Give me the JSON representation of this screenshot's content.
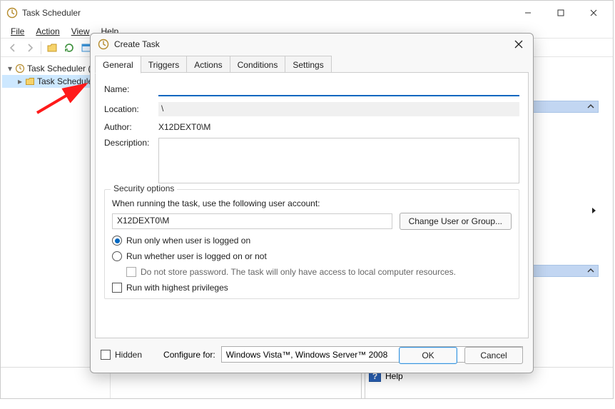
{
  "window": {
    "title": "Task Scheduler",
    "menu": {
      "file": "File",
      "action": "Action",
      "view": "View",
      "help": "Help"
    }
  },
  "tree": {
    "root": "Task Scheduler (L",
    "child": "Task Schedule"
  },
  "status": {
    "help": "Help"
  },
  "dialog": {
    "title": "Create Task",
    "tabs": {
      "general": "General",
      "triggers": "Triggers",
      "actions": "Actions",
      "conditions": "Conditions",
      "settings": "Settings"
    },
    "labels": {
      "name": "Name:",
      "location": "Location:",
      "author": "Author:",
      "description": "Description:"
    },
    "values": {
      "name": "",
      "location": "\\",
      "author": "X12DEXT0\\M"
    },
    "security": {
      "group_title": "Security options",
      "whenline": "When running the task, use the following user account:",
      "user": "X12DEXT0\\M",
      "change_btn": "Change User or Group...",
      "radio_logged": "Run only when user is logged on",
      "radio_whether": "Run whether user is logged on or not",
      "nostore": "Do not store password.  The task will only have access to local computer resources.",
      "highest": "Run with highest privileges"
    },
    "bottom": {
      "hidden": "Hidden",
      "configure_for": "Configure for:",
      "configure_val": "Windows Vista™, Windows Server™ 2008"
    },
    "buttons": {
      "ok": "OK",
      "cancel": "Cancel"
    }
  }
}
